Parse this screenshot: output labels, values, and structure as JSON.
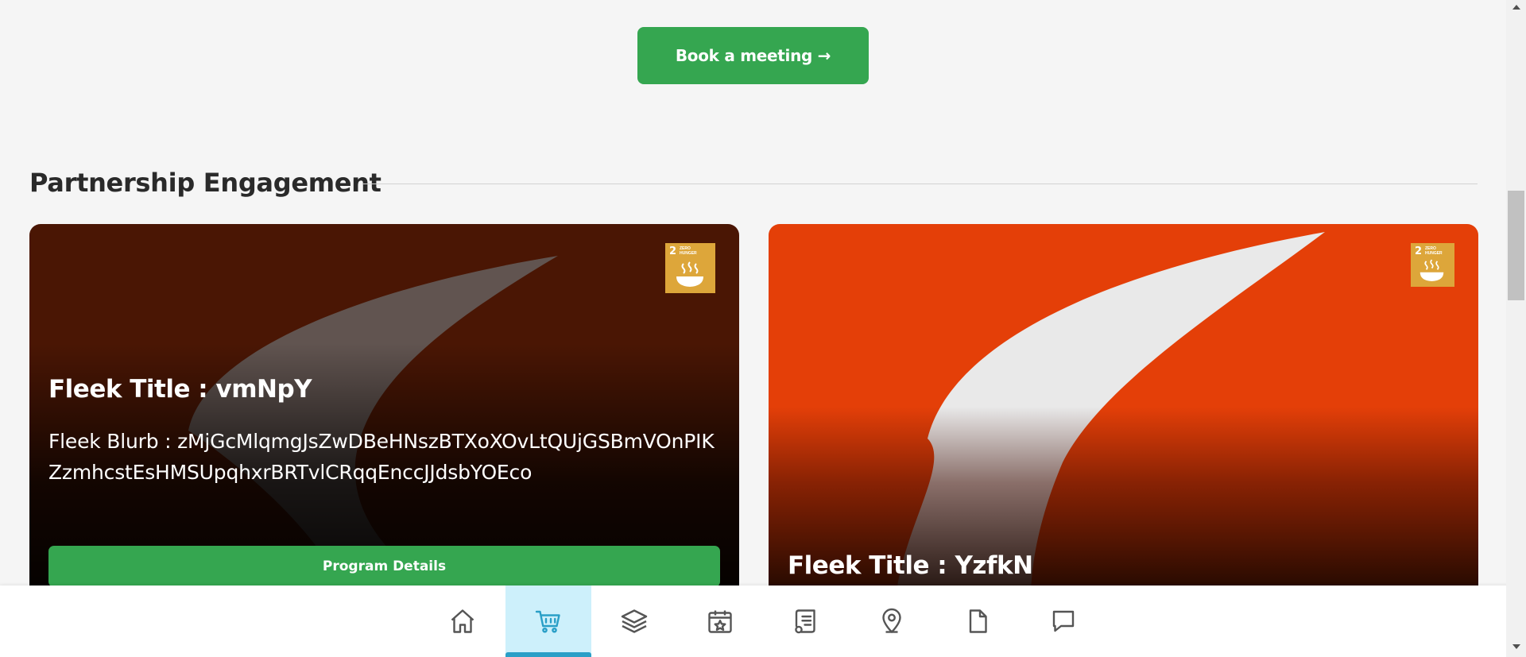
{
  "header": {
    "book_meeting_label": "Book a meeting →"
  },
  "section": {
    "title": "Partnership Engagement"
  },
  "cards": [
    {
      "sdg_number": "2",
      "sdg_text": "ZERO HUNGER",
      "title": "Fleek Title : vmNpY",
      "blurb": "Fleek Blurb : zMjGcMlqmgJsZwDBeHNszBTXoXOvLtQUjGSBmVOnPIKZzmhcstEsHMSUpqhxrBRTvlCRqqEnccJJdsbYOEco",
      "button_label": "Program Details"
    },
    {
      "sdg_number": "2",
      "sdg_text": "ZERO HUNGER",
      "title": "Fleek Title : YzfkN"
    }
  ],
  "bottom_nav": {
    "items": [
      "home-icon",
      "cart-icon",
      "layers-icon",
      "calendar-star-icon",
      "document-list-icon",
      "location-pin-icon",
      "file-icon",
      "chat-icon"
    ],
    "active": "cart-icon",
    "active_color": "#2a9fc7"
  },
  "colors": {
    "accent_green": "#35a650",
    "sdg_gold": "#dda63a"
  }
}
